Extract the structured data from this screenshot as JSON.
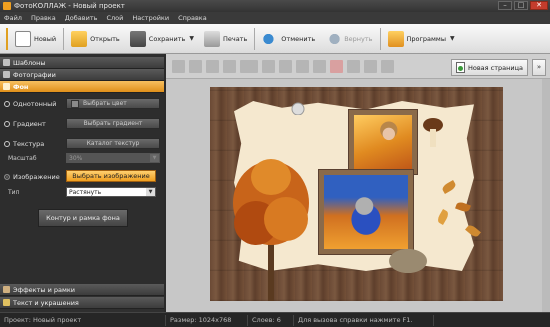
{
  "window": {
    "title": "ФотоКОЛЛАЖ - Новый проект"
  },
  "menu": [
    "Файл",
    "Правка",
    "Добавить",
    "Слой",
    "Настройки",
    "Справка"
  ],
  "toolbar": {
    "new": "Новый",
    "open": "Открыть",
    "save": "Сохранить",
    "print": "Печать",
    "undo": "Отменить",
    "redo": "Вернуть",
    "programs": "Программы"
  },
  "panel": {
    "templates": "Шаблоны",
    "photos": "Фотографии",
    "background": "Фон",
    "solid": "Однотонный",
    "choose_color": "Выбрать цвет",
    "gradient": "Градиент",
    "choose_gradient": "Выбрать градиент",
    "texture": "Текстура",
    "texture_catalog": "Каталог текстур",
    "scale_label": "Масштаб",
    "scale_value": "30%",
    "image": "Изображение",
    "choose_image": "Выбрать изображение",
    "type_label": "Тип",
    "type_value": "Растянуть",
    "contour_button": "Контур и рамка фона",
    "effects": "Эффекты и рамки",
    "text": "Текст и украшения"
  },
  "canvas_toolbar": {
    "new_page": "Новая страница"
  },
  "colors": {
    "accent": "#f0a020",
    "close": "#c53c2c"
  },
  "status": {
    "project": "Проект: Новый проект",
    "size": "Размер: 1024x768",
    "layers": "Слоев: 6",
    "help": "Для вызова справки нажмите F1."
  }
}
